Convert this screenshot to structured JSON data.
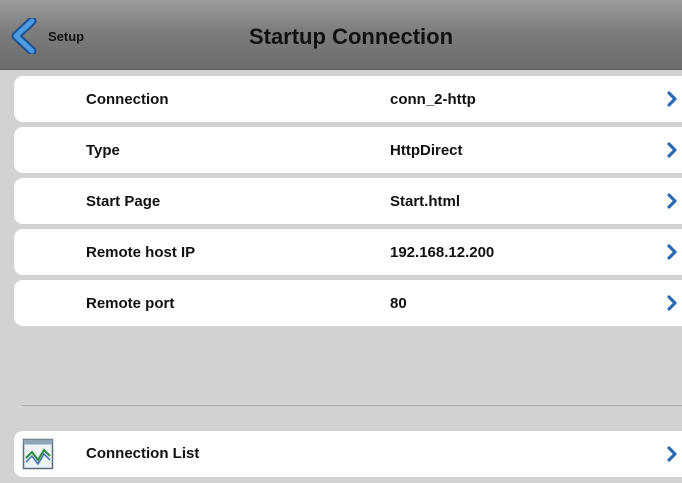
{
  "header": {
    "back_label": "Setup",
    "title": "Startup Connection"
  },
  "rows": [
    {
      "label": "Connection",
      "value": "conn_2-http"
    },
    {
      "label": "Type",
      "value": "HttpDirect"
    },
    {
      "label": "Start Page",
      "value": "Start.html"
    },
    {
      "label": "Remote host IP",
      "value": "192.168.12.200"
    },
    {
      "label": "Remote port",
      "value": "80"
    }
  ],
  "connection_list": {
    "label": "Connection List",
    "icon": "connection-list-icon"
  },
  "colors": {
    "accent_chevron": "#2a6bb3",
    "header_bg": "#7d7d7d",
    "page_bg": "#d2d2d2"
  }
}
